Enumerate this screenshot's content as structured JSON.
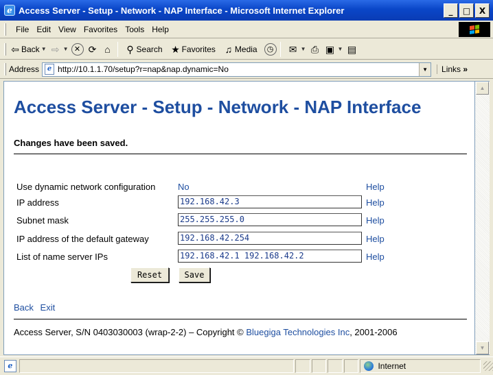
{
  "window": {
    "title": "Access Server - Setup - Network - NAP Interface - Microsoft Internet Explorer",
    "min_glyph": "_",
    "max_glyph": "□",
    "close_glyph": "X"
  },
  "menu": [
    "File",
    "Edit",
    "View",
    "Favorites",
    "Tools",
    "Help"
  ],
  "toolbar": {
    "back_label": "Back",
    "search_label": "Search",
    "favorites_label": "Favorites",
    "media_label": "Media"
  },
  "address": {
    "label": "Address",
    "url": "http://10.1.1.70/setup?r=nap&nap.dynamic=No",
    "links_label": "Links"
  },
  "page": {
    "heading": "Access Server - Setup - Network - NAP Interface",
    "saved_message": "Changes have been saved.",
    "rows": [
      {
        "label": "Use dynamic network configuration",
        "value": "No",
        "help": "Help"
      },
      {
        "label": "IP address",
        "value": "192.168.42.3",
        "help": "Help"
      },
      {
        "label": "Subnet mask",
        "value": "255.255.255.0",
        "help": "Help"
      },
      {
        "label": "IP address of the default gateway",
        "value": "192.168.42.254",
        "help": "Help"
      },
      {
        "label": "List of name server IPs",
        "value": "192.168.42.1 192.168.42.2",
        "help": "Help"
      }
    ],
    "reset_label": "Reset",
    "save_label": "Save",
    "nav_back": "Back",
    "nav_exit": "Exit",
    "footer_prefix": "Access Server, S/N 0403030003 (wrap-2-2)  –  Copyright ©",
    "footer_company": "Bluegiga Technologies Inc",
    "footer_suffix": ", 2001-2006"
  },
  "status": {
    "zone_label": "Internet"
  },
  "colors": {
    "heading": "#1e4ea0",
    "link": "#1e4ea0",
    "titlebar": "#0a46c8"
  }
}
